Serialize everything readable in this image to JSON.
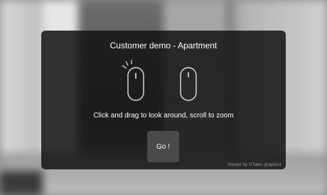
{
  "panel": {
    "title": "Customer demo - Apartment",
    "instructions": "Click and drag to look around, scroll to zoom",
    "go_label": "Go !",
    "credit": "Viewer by VTales graphics"
  },
  "icons": {
    "left": "mouse-click-drag-icon",
    "right": "mouse-scroll-icon"
  },
  "colors": {
    "panel_background": "#141414",
    "button_background": "#4a4a4a",
    "text": "#ffffff",
    "icon_stroke": "#e0e0e0",
    "credit_text": "#9a9a9a"
  }
}
